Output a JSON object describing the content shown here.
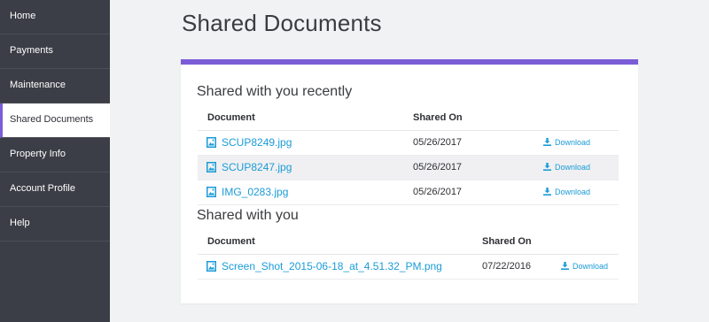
{
  "sidebar": {
    "items": [
      {
        "label": "Home",
        "active": false
      },
      {
        "label": "Payments",
        "active": false
      },
      {
        "label": "Maintenance",
        "active": false
      },
      {
        "label": "Shared Documents",
        "active": true
      },
      {
        "label": "Property Info",
        "active": false
      },
      {
        "label": "Account Profile",
        "active": false
      },
      {
        "label": "Help",
        "active": false
      }
    ]
  },
  "page": {
    "title": "Shared Documents"
  },
  "colors": {
    "accent": "#7b5cd6",
    "link": "#1a9bd7",
    "sidebar_bg": "#3b3e46"
  },
  "recent": {
    "title": "Shared with you recently",
    "headers": {
      "document": "Document",
      "shared_on": "Shared On"
    },
    "rows": [
      {
        "name": "SCUP8249.jpg",
        "date": "05/26/2017",
        "action": "Download",
        "icon": "image-file-icon"
      },
      {
        "name": "SCUP8247.jpg",
        "date": "05/26/2017",
        "action": "Download",
        "icon": "image-file-icon"
      },
      {
        "name": "IMG_0283.jpg",
        "date": "05/26/2017",
        "action": "Download",
        "icon": "image-file-icon"
      }
    ]
  },
  "shared": {
    "title": "Shared with you",
    "headers": {
      "document": "Document",
      "shared_on": "Shared On"
    },
    "rows": [
      {
        "name": "Screen_Shot_2015-06-18_at_4.51.32_PM.png",
        "date": "07/22/2016",
        "action": "Download",
        "icon": "image-file-icon"
      }
    ]
  }
}
